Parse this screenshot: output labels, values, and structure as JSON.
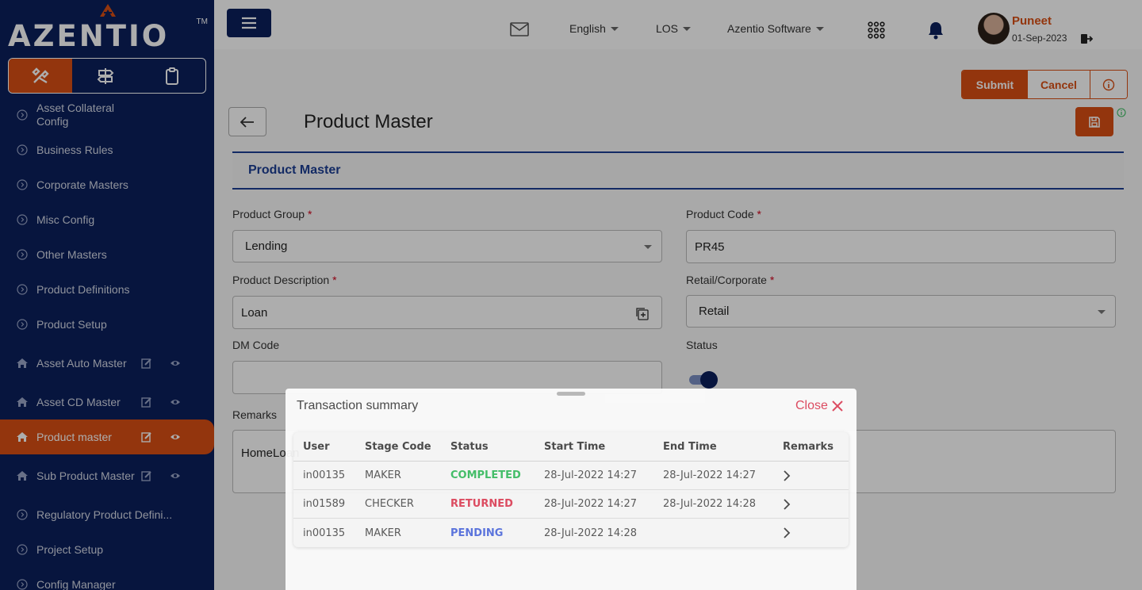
{
  "brand": {
    "name": "AZENTIO",
    "tm": "TM"
  },
  "sidebar": {
    "items": [
      {
        "label": "Asset Collateral Config"
      },
      {
        "label": "Business Rules"
      },
      {
        "label": "Corporate Masters"
      },
      {
        "label": "Misc Config"
      },
      {
        "label": "Other Masters"
      },
      {
        "label": "Product Definitions"
      },
      {
        "label": "Product Setup"
      },
      {
        "label": "Asset Auto Master"
      },
      {
        "label": "Asset CD Master"
      },
      {
        "label": "Product master"
      },
      {
        "label": "Sub Product Master"
      },
      {
        "label": "Regulatory Product Defini..."
      },
      {
        "label": "Project Setup"
      },
      {
        "label": "Config Manager"
      }
    ]
  },
  "topbar": {
    "language": "English",
    "module": "LOS",
    "company": "Azentio Software",
    "user_name": "Puneet",
    "date": "01-Sep-2023"
  },
  "toolbar": {
    "submit": "Submit",
    "cancel": "Cancel"
  },
  "page": {
    "title": "Product Master",
    "section": "Product Master"
  },
  "form": {
    "product_group": {
      "label": "Product Group",
      "value": "Lending"
    },
    "product_code": {
      "label": "Product Code",
      "value": "PR45"
    },
    "product_description": {
      "label": "Product Description",
      "value": "Loan"
    },
    "retail_corporate": {
      "label": "Retail/Corporate",
      "value": "Retail"
    },
    "dm_code": {
      "label": "DM Code",
      "value": ""
    },
    "status": {
      "label": "Status",
      "enabled": true
    },
    "remarks": {
      "label": "Remarks",
      "value": "HomeLoan"
    },
    "required_mark": "*"
  },
  "modal": {
    "title": "Transaction summary",
    "close": "Close",
    "columns": [
      "User",
      "Stage Code",
      "Status",
      "Start Time",
      "End Time",
      "Remarks"
    ],
    "rows": [
      {
        "user": "in00135",
        "stage": "MAKER",
        "status": "COMPLETED",
        "status_color": "#3cbf63",
        "start": "28-Jul-2022 14:27",
        "end": "28-Jul-2022 14:27"
      },
      {
        "user": "in01589",
        "stage": "CHECKER",
        "status": "RETURNED",
        "status_color": "#e0455c",
        "start": "28-Jul-2022 14:27",
        "end": "28-Jul-2022 14:28"
      },
      {
        "user": "in00135",
        "stage": "MAKER",
        "status": "PENDING",
        "status_color": "#5670e0",
        "start": "28-Jul-2022 14:28",
        "end": ""
      }
    ]
  },
  "colors": {
    "primary": "#0b1f5c",
    "accent": "#d94f14",
    "section": "#1c3f94"
  }
}
